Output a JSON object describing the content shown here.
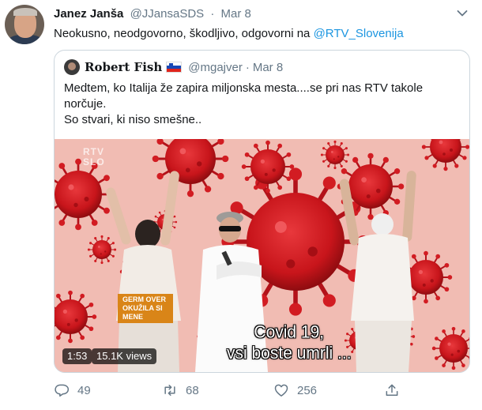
{
  "tweet": {
    "author_name": "Janez Janša",
    "author_handle": "@JJansaSDS",
    "separator": "·",
    "date": "Mar 8",
    "text": "Neokusno, neodgovorno, škodljivo, odgovorni na ",
    "mention": "@RTV_Slovenija"
  },
  "quoted": {
    "author_name": "Robert Fish",
    "flag_icon": "slovenia-flag-icon",
    "author_handle": "@mgajver",
    "separator": "·",
    "date": "Mar 8",
    "lines": [
      "Medtem, ko Italija že zapira miljonska mesta....se pri nas RTV takole",
      "norčuje.",
      "So stvari, ki niso smešne.."
    ],
    "video": {
      "caption_line1": "Covid 19,",
      "caption_line2": "vsi boste umrli ...",
      "lower_third_line1": "GERM OVER",
      "lower_third_line2": "OKUŽILA SI MENE",
      "watermark_line1": "RTV",
      "watermark_line2": "SLO",
      "duration": "1:53",
      "views": "15.1K views"
    }
  },
  "actions": {
    "replies": "49",
    "retweets": "68",
    "likes": "256"
  },
  "colors": {
    "link": "#1b95e0",
    "secondary": "#657786",
    "virus": "#c8151b",
    "video_bg": "#f0b9b1"
  }
}
